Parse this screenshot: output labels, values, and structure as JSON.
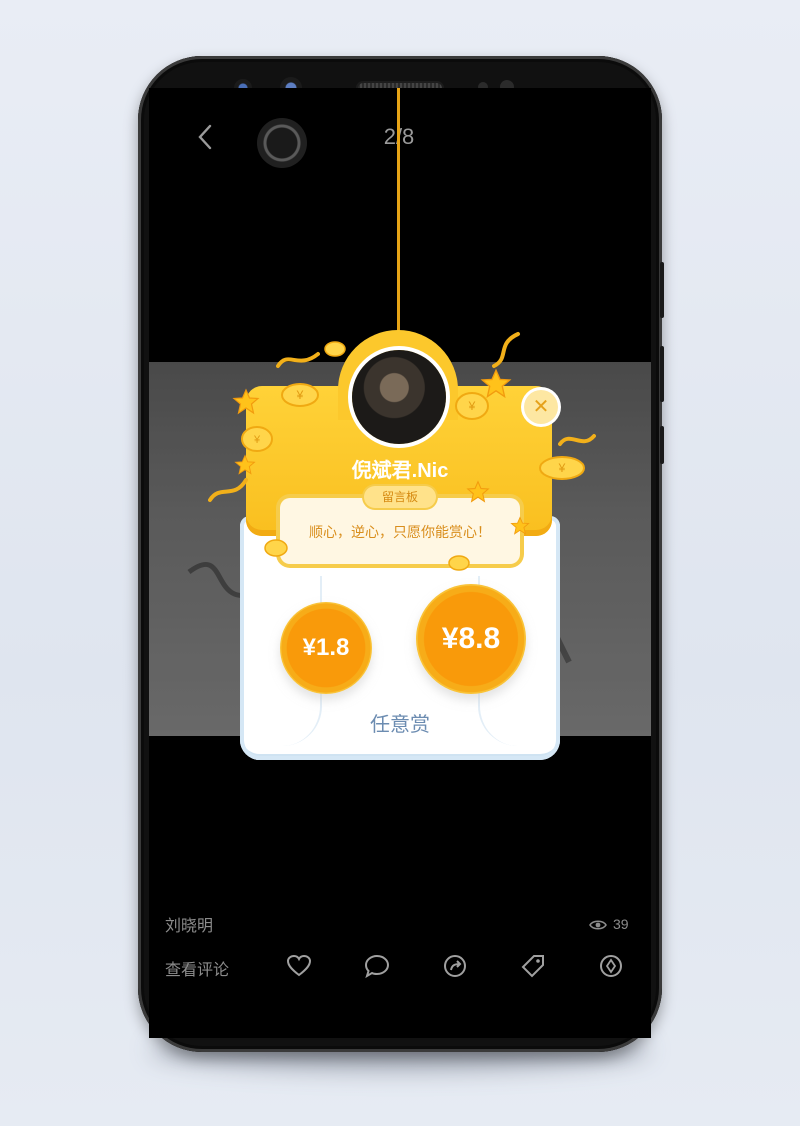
{
  "header": {
    "counter": "2/8"
  },
  "reward_card": {
    "author_name": "倪斌君.Nic",
    "message_label": "留言板",
    "message": "顺心，逆心，只愿你能赏心！",
    "amount_small": "¥1.8",
    "amount_big": "¥8.8",
    "any_amount_label": "任意赏",
    "close_icon": "close-icon"
  },
  "footer": {
    "username": "刘晓明",
    "views": "39",
    "view_comments_label": "查看评论",
    "icons": [
      "heart-icon",
      "comment-icon",
      "share-icon",
      "tag-icon",
      "diamond-icon"
    ]
  },
  "colors": {
    "accent_yellow": "#fcc82c",
    "coin_orange": "#f99a0a",
    "text_blue": "#6c8cb1"
  }
}
